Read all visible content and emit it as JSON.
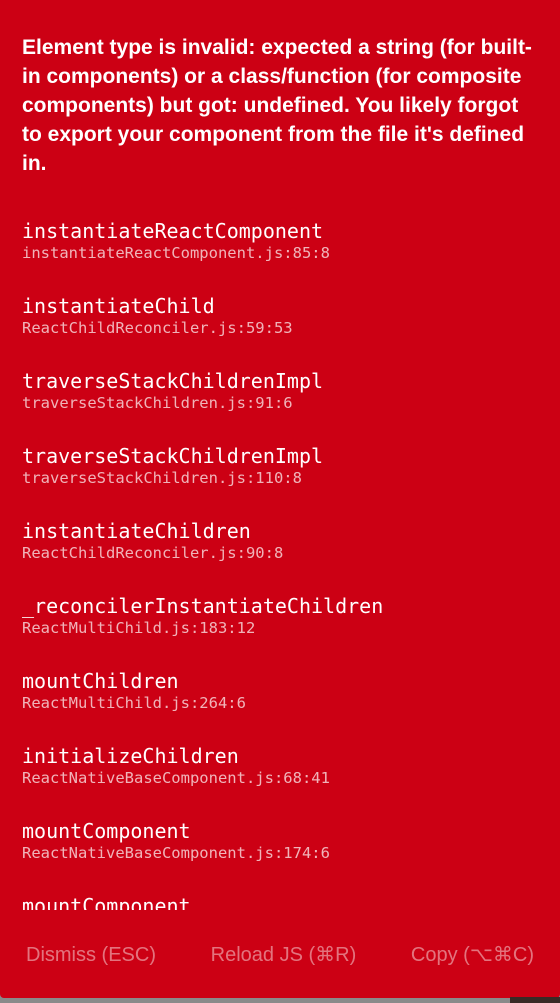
{
  "error_message": "Element type is invalid: expected a string (for built-in components) or a class/function (for composite components) but got: undefined. You likely forgot to export your component from the file it's defined in.",
  "stack": [
    {
      "method": "instantiateReactComponent",
      "file": "instantiateReactComponent.js:85:8"
    },
    {
      "method": "instantiateChild",
      "file": "ReactChildReconciler.js:59:53"
    },
    {
      "method": "traverseStackChildrenImpl",
      "file": "traverseStackChildren.js:91:6"
    },
    {
      "method": "traverseStackChildrenImpl",
      "file": "traverseStackChildren.js:110:8"
    },
    {
      "method": "instantiateChildren",
      "file": "ReactChildReconciler.js:90:8"
    },
    {
      "method": "_reconcilerInstantiateChildren",
      "file": "ReactMultiChild.js:183:12"
    },
    {
      "method": "mountChildren",
      "file": "ReactMultiChild.js:264:6"
    },
    {
      "method": "initializeChildren",
      "file": "ReactNativeBaseComponent.js:68:41"
    },
    {
      "method": "mountComponent",
      "file": "ReactNativeBaseComponent.js:174:6"
    },
    {
      "method": "mountComponent",
      "file": ""
    }
  ],
  "buttons": {
    "dismiss": "Dismiss (ESC)",
    "reload": "Reload JS (⌘R)",
    "copy": "Copy (⌥⌘C)"
  },
  "colors": {
    "background": "#cc0014"
  }
}
